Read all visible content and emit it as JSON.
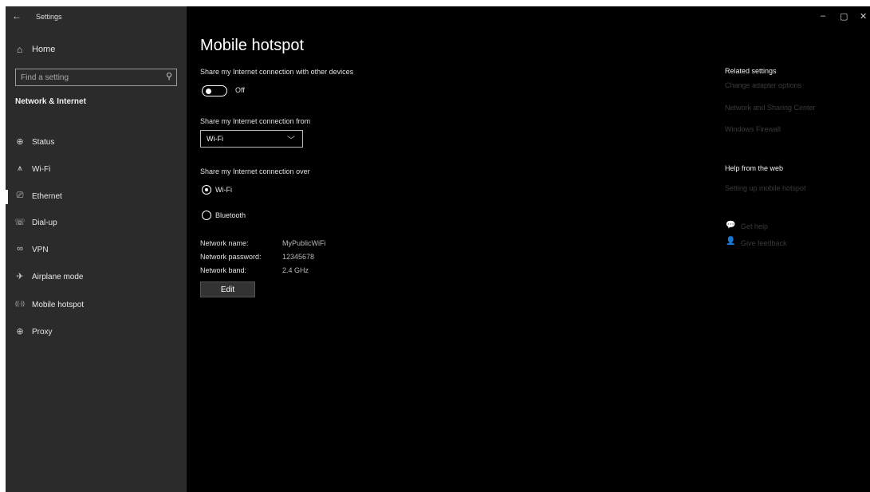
{
  "window": {
    "title": "Settings",
    "back_glyph": "←",
    "controls": {
      "minimize": "–",
      "maximize": "▢",
      "close": "✕"
    }
  },
  "sidebar": {
    "home_label": "Home",
    "home_icon": "⌂",
    "search": {
      "placeholder": "Find a setting",
      "icon": "⚲"
    },
    "section_title": "Network & Internet",
    "items": [
      {
        "label": "Status",
        "icon": "⊕",
        "icon_name": "status-icon"
      },
      {
        "label": "Wi-Fi",
        "icon": "⩚",
        "icon_name": "wifi-icon"
      },
      {
        "label": "Ethernet",
        "icon": "⎚",
        "icon_name": "ethernet-icon",
        "selected": true
      },
      {
        "label": "Dial-up",
        "icon": "☏",
        "icon_name": "dialup-icon"
      },
      {
        "label": "VPN",
        "icon": "∞",
        "icon_name": "vpn-icon"
      },
      {
        "label": "Airplane mode",
        "icon": "✈",
        "icon_name": "airplane-icon"
      },
      {
        "label": "Mobile hotspot",
        "icon": "((·))",
        "icon_name": "hotspot-icon"
      },
      {
        "label": "Proxy",
        "icon": "⊕",
        "icon_name": "proxy-icon"
      }
    ]
  },
  "main": {
    "title": "Mobile hotspot",
    "share_label": "Share my Internet connection with other devices",
    "toggle_state": "Off",
    "share_from_label": "Share my Internet connection from",
    "share_from_value": "Wi-Fi",
    "chevron": "﹀",
    "share_over_label": "Share my Internet connection over",
    "radio_options": [
      {
        "label": "Wi-Fi",
        "selected": true
      },
      {
        "label": "Bluetooth",
        "selected": false
      }
    ],
    "network": {
      "name_label": "Network name:",
      "name_value": "MyPublicWiFi",
      "password_label": "Network password:",
      "password_value": "12345678",
      "band_label": "Network band:",
      "band_value": "2.4 GHz"
    },
    "edit_label": "Edit"
  },
  "right_panel": {
    "related_title": "Related settings",
    "related_links": [
      "Change adapter options",
      "Network and Sharing Center",
      "Windows Firewall"
    ],
    "help_title": "Help from the web",
    "help_links": [
      "Setting up mobile hotspot"
    ],
    "get_help": "Get help",
    "get_help_icon": "💬",
    "give_feedback": "Give feedback",
    "give_feedback_icon": "👤"
  },
  "colors": {
    "sidebar_bg": "#2b2b2b",
    "main_bg": "#000000",
    "link_dim": "#3a3a3a"
  }
}
